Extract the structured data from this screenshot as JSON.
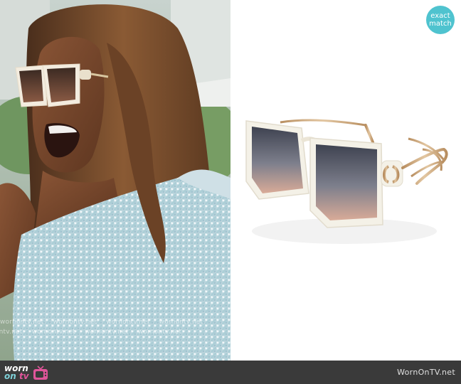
{
  "badge": {
    "line1": "exact",
    "line2": "match"
  },
  "watermark": {
    "text": "wornontv.net"
  },
  "footer": {
    "logo_worn": "worn",
    "logo_on": "on",
    "logo_tv": "tv",
    "site_name": "WornOnTV.net"
  },
  "colors": {
    "badge": "#4fc3cf",
    "footer_bg": "#3a3a3a",
    "frame_cream": "#f3f0e6",
    "gold": "#c9a57a"
  }
}
